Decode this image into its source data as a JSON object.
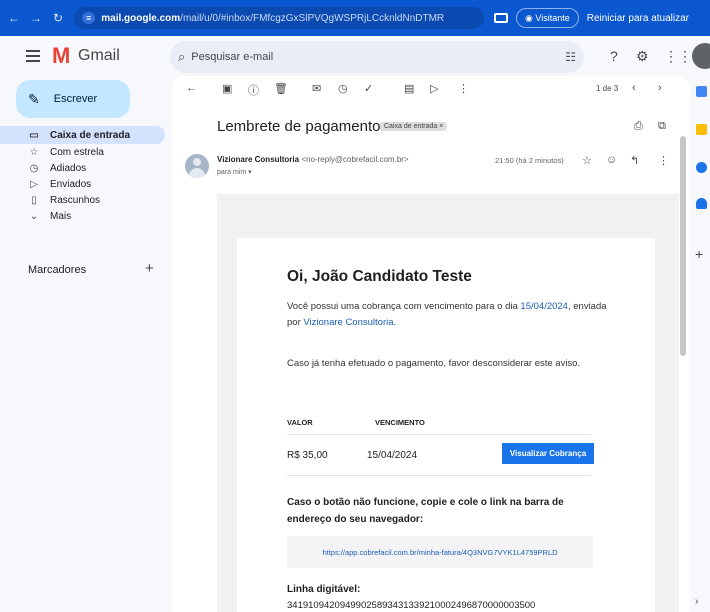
{
  "browser": {
    "url_host": "mail.google.com",
    "url_rest": "/mail/u/0/#inbox/FMfcgzGxSlPVQgWSPRjLCcknldNnDTMR",
    "visitor_label": "Visitante",
    "restart_label": "Reiniciar para atualizar"
  },
  "header": {
    "app_name": "Gmail",
    "search_placeholder": "Pesquisar e-mail"
  },
  "sidebar": {
    "compose_label": "Escrever",
    "items": [
      {
        "label": "Caixa de entrada",
        "icon": "inbox-icon",
        "active": true
      },
      {
        "label": "Com estrela",
        "icon": "star-icon"
      },
      {
        "label": "Adiados",
        "icon": "clock-icon"
      },
      {
        "label": "Enviados",
        "icon": "send-icon"
      },
      {
        "label": "Rascunhos",
        "icon": "draft-icon"
      },
      {
        "label": "Mais",
        "icon": "chevron-down-icon"
      }
    ],
    "labels_title": "Marcadores"
  },
  "message": {
    "pagination": "1 de 3",
    "subject": "Lembrete de pagamento",
    "subject_tag": "Caixa de entrada ×",
    "sender_name": "Vizionare Consultoria",
    "sender_email": "<no-reply@cobrefacil.com.br>",
    "recipient": "para mim ▾",
    "time": "21:50 (há 2 minutos)"
  },
  "email": {
    "greeting": "Oi, João Candidato Teste",
    "intro_before_date": "Você possui uma cobrança com vencimento para o dia ",
    "due_date_link": "15/04/2024",
    "intro_middle": ", enviada por ",
    "company_link": "Vizionare Consultoria",
    "intro_end": ".",
    "disregard": "Caso já tenha efetuado o pagamento, favor desconsiderar este aviso.",
    "col_value": "VALOR",
    "col_due": "VENCIMENTO",
    "amount": "R$ 35,00",
    "due_date": "15/04/2024",
    "view_button": "Visualizar Cobrança",
    "fallback_note": "Caso o botão não funcione, copie e cole o link na barra de endereço do seu navegador:",
    "invoice_link": "https://app.cobrefacil.com.br/minha-fatura/4Q3NVG7VYK1L4759PRLD",
    "barcode_label": "Linha digitável:",
    "barcode_value": "34191094209499025893431339210002496870000003500"
  },
  "colors": {
    "browser_bar": "#0b57d0",
    "compose_bg": "#c2e7ff",
    "active_nav": "#d3e3fd",
    "button_blue": "#1a73e8",
    "link_blue": "#1a5fb4"
  }
}
